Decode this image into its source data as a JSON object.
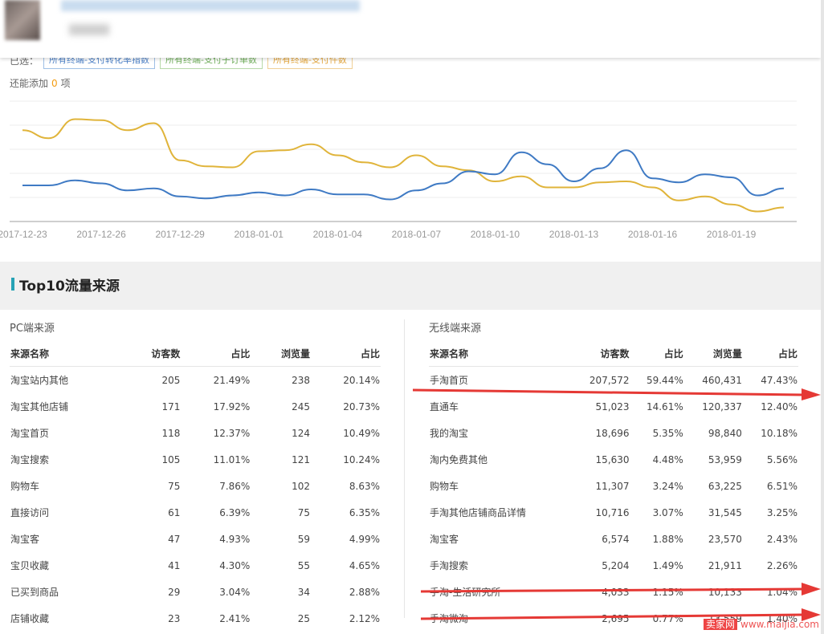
{
  "selected": {
    "label": "已选：",
    "chips": [
      {
        "text": "所有终端-支付转化率指数",
        "color": "#4a7fc6"
      },
      {
        "text": "所有终端-支付子订单数",
        "color": "#6fae5a"
      },
      {
        "text": "所有终端-支付件数",
        "color": "#e3a53b"
      }
    ],
    "addable_prefix": "还能添加",
    "addable_count": "0",
    "addable_suffix": "项"
  },
  "chart_data": {
    "type": "line",
    "x": [
      "2017-12-23",
      "2017-12-24",
      "2017-12-25",
      "2017-12-26",
      "2017-12-27",
      "2017-12-28",
      "2017-12-29",
      "2017-12-30",
      "2017-12-31",
      "2018-01-01",
      "2018-01-02",
      "2018-01-03",
      "2018-01-04",
      "2018-01-05",
      "2018-01-06",
      "2018-01-07",
      "2018-01-08",
      "2018-01-09",
      "2018-01-10",
      "2018-01-11",
      "2018-01-12",
      "2018-01-13",
      "2018-01-14",
      "2018-01-15",
      "2018-01-16",
      "2018-01-17",
      "2018-01-18",
      "2018-01-19",
      "2018-01-20",
      "2018-01-21"
    ],
    "tick_labels": [
      "2017-12-23",
      "2017-12-26",
      "2017-12-29",
      "2018-01-01",
      "2018-01-04",
      "2018-01-07",
      "2018-01-10",
      "2018-01-13",
      "2018-01-16",
      "2018-01-19"
    ],
    "series": [
      {
        "color": "#e0b43a",
        "values": [
          91,
          83,
          102,
          101,
          91,
          98,
          61,
          55,
          54,
          70,
          71,
          77,
          66,
          59,
          54,
          66,
          55,
          51,
          40,
          45,
          34,
          34,
          39,
          40,
          34,
          21,
          25,
          17,
          10,
          14
        ]
      },
      {
        "color": "#3f7ac4",
        "values": [
          36,
          36,
          41,
          38,
          31,
          33,
          25,
          23,
          26,
          29,
          26,
          32,
          27,
          27,
          22,
          31,
          38,
          50,
          47,
          69,
          57,
          40,
          53,
          71,
          43,
          39,
          47,
          44,
          26,
          33
        ]
      }
    ],
    "ylim": [
      0,
      120
    ],
    "grid": true
  },
  "section": {
    "title": "Top10流量来源"
  },
  "pc": {
    "title": "PC端来源",
    "headers": [
      "来源名称",
      "访客数",
      "占比",
      "浏览量",
      "占比"
    ],
    "rows": [
      [
        "淘宝站内其他",
        "205",
        "21.49%",
        "238",
        "20.14%"
      ],
      [
        "淘宝其他店铺",
        "171",
        "17.92%",
        "245",
        "20.73%"
      ],
      [
        "淘宝首页",
        "118",
        "12.37%",
        "124",
        "10.49%"
      ],
      [
        "淘宝搜索",
        "105",
        "11.01%",
        "121",
        "10.24%"
      ],
      [
        "购物车",
        "75",
        "7.86%",
        "102",
        "8.63%"
      ],
      [
        "直接访问",
        "61",
        "6.39%",
        "75",
        "6.35%"
      ],
      [
        "淘宝客",
        "47",
        "4.93%",
        "59",
        "4.99%"
      ],
      [
        "宝贝收藏",
        "41",
        "4.30%",
        "55",
        "4.65%"
      ],
      [
        "已买到商品",
        "29",
        "3.04%",
        "34",
        "2.88%"
      ],
      [
        "店铺收藏",
        "23",
        "2.41%",
        "25",
        "2.12%"
      ]
    ]
  },
  "mobile": {
    "title": "无线端来源",
    "headers": [
      "来源名称",
      "访客数",
      "占比",
      "浏览量",
      "占比"
    ],
    "rows": [
      [
        "手淘首页",
        "207,572",
        "59.44%",
        "460,431",
        "47.43%"
      ],
      [
        "直通车",
        "51,023",
        "14.61%",
        "120,337",
        "12.40%"
      ],
      [
        "我的淘宝",
        "18,696",
        "5.35%",
        "98,840",
        "10.18%"
      ],
      [
        "淘内免费其他",
        "15,630",
        "4.48%",
        "53,959",
        "5.56%"
      ],
      [
        "购物车",
        "11,307",
        "3.24%",
        "63,225",
        "6.51%"
      ],
      [
        "手淘其他店铺商品详情",
        "10,716",
        "3.07%",
        "31,545",
        "3.25%"
      ],
      [
        "淘宝客",
        "6,574",
        "1.88%",
        "23,570",
        "2.43%"
      ],
      [
        "手淘搜索",
        "5,204",
        "1.49%",
        "21,911",
        "2.26%"
      ],
      [
        "手淘-生活研究所",
        "4,033",
        "1.15%",
        "10,133",
        "1.04%"
      ],
      [
        "手淘微淘",
        "2,695",
        "0.77%",
        "13,559",
        "1.40%"
      ]
    ]
  },
  "watermark": {
    "brand": "卖家网",
    "url": "www.maijia.com"
  }
}
